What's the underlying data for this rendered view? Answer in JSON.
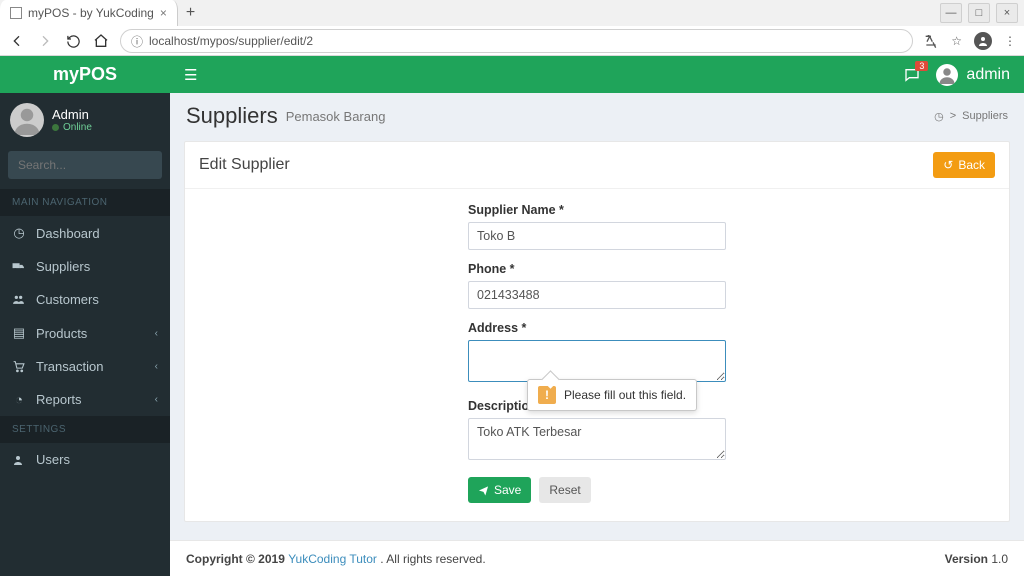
{
  "browser": {
    "tab_title": "myPOS - by YukCoding",
    "url": "localhost/mypos/supplier/edit/2"
  },
  "brand": "myPOS",
  "user": {
    "name": "Admin",
    "status": "Online",
    "topbar_name": "admin",
    "msg_badge": "3"
  },
  "search": {
    "placeholder": "Search..."
  },
  "nav_sections": {
    "main": "MAIN NAVIGATION",
    "settings": "SETTINGS"
  },
  "nav": {
    "dashboard": "Dashboard",
    "suppliers": "Suppliers",
    "customers": "Customers",
    "products": "Products",
    "transaction": "Transaction",
    "reports": "Reports",
    "users": "Users"
  },
  "page": {
    "title": "Suppliers",
    "subtitle": "Pemasok Barang",
    "crumb_home_icon": "dashboard-icon",
    "crumb_sep": ">",
    "crumb_current": "Suppliers"
  },
  "box": {
    "title": "Edit Supplier",
    "back_label": "Back"
  },
  "form": {
    "supplier_name": {
      "label": "Supplier Name *",
      "value": "Toko B"
    },
    "phone": {
      "label": "Phone *",
      "value": "021433488"
    },
    "address": {
      "label": "Address *",
      "value": ""
    },
    "description": {
      "label": "Description",
      "value": "Toko ATK Terbesar"
    },
    "save_label": "Save",
    "reset_label": "Reset",
    "validation_msg": "Please fill out this field."
  },
  "footer": {
    "copy_prefix": "Copyright © 2019 ",
    "copy_link": "YukCoding Tutor",
    "copy_suffix": ". All rights reserved.",
    "version_label": "Version",
    "version_value": " 1.0"
  }
}
